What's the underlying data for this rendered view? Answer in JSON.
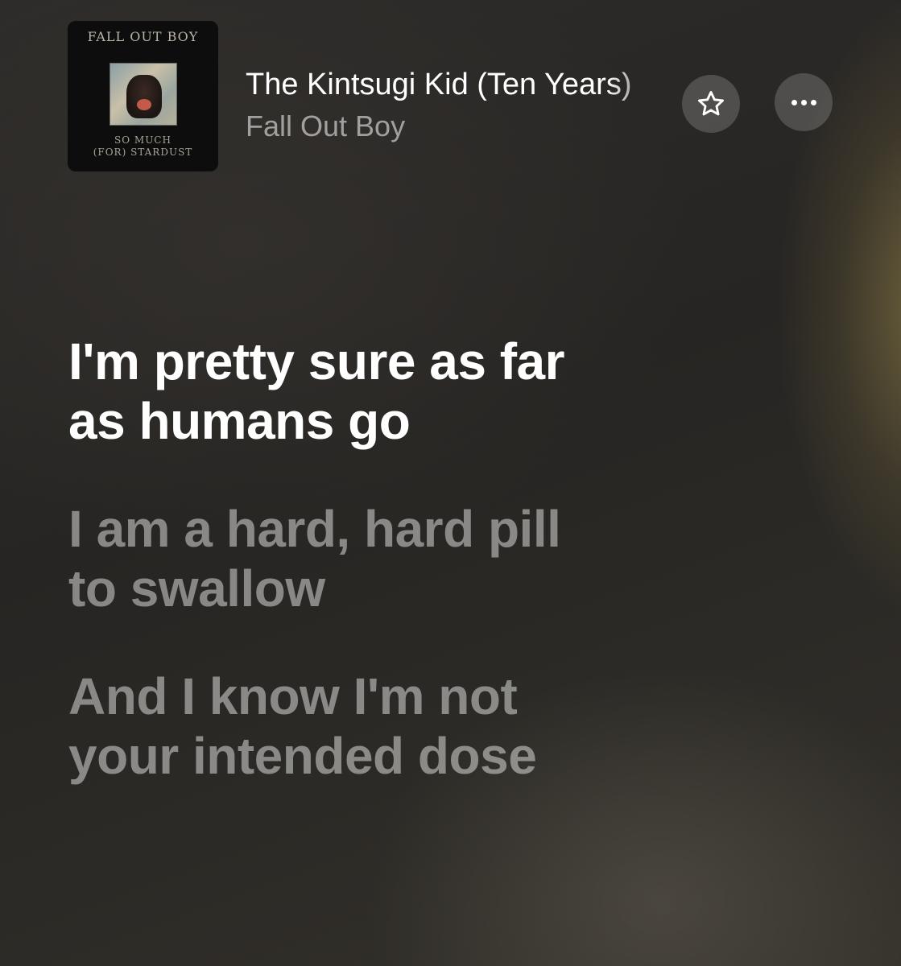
{
  "now_playing": {
    "artwork": {
      "band_text": "FALL OUT BOY",
      "album_text_line1": "SO MUCH",
      "album_text_line2": "(FOR) STARDUST"
    },
    "title": "The Kintsugi Kid (Ten Years)",
    "artist": "Fall Out Boy",
    "favorite_icon": "star-icon",
    "more_icon": "ellipsis-icon"
  },
  "lyrics": [
    {
      "line1": "I'm pretty sure as far",
      "line2": "as humans go",
      "state": "active"
    },
    {
      "line1": "I am a hard, hard pill",
      "line2": "to swallow",
      "state": "upcoming"
    },
    {
      "line1": "And I know I'm not",
      "line2": "your intended dose",
      "state": "upcoming"
    }
  ],
  "colors": {
    "active_lyric": "#ffffff",
    "inactive_lyric": "rgba(255,255,255,0.45)",
    "accent_glow": "#a8965a"
  }
}
